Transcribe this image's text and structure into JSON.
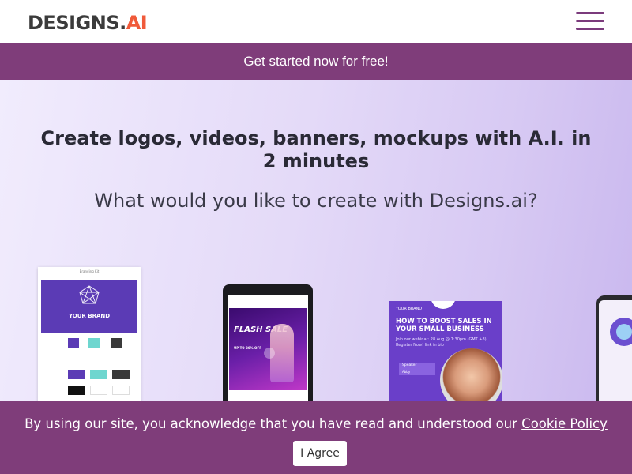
{
  "header": {
    "logo_text": "DESIGNS.",
    "logo_ai": "AI",
    "menu_icon": "hamburger-menu-icon"
  },
  "promo": {
    "text": "Get started now for free!"
  },
  "hero": {
    "title": "Create logos, videos, banners, mockups with A.I. in 2 minutes",
    "subtitle": "What would you like to create with Designs.ai?"
  },
  "cards": {
    "branding": {
      "kit_title": "Branding Kit",
      "brand_text": "YOUR BRAND"
    },
    "video": {
      "headline": "FLASH SALE",
      "offer": "UP TO 30% OFF"
    },
    "webinar": {
      "brand": "YOUR BRAND",
      "title": "HOW TO BOOST SALES IN YOUR SMALL BUSINESS",
      "subtitle": "Join our webinar: 28 Aug @ 7:30pm (GMT +8) Register Now! link in bio",
      "speaker_label": "Speaker",
      "speaker_name": "Abby",
      "speaker_role": "Founder of Your Brand"
    }
  },
  "cookie": {
    "message": "By using our site, you acknowledge that you have read and understood our",
    "link": "Cookie Policy",
    "agree_button": "I Agree"
  },
  "colors": {
    "brand_purple": "#7f3d7a",
    "text_dark": "#2a2a36"
  }
}
